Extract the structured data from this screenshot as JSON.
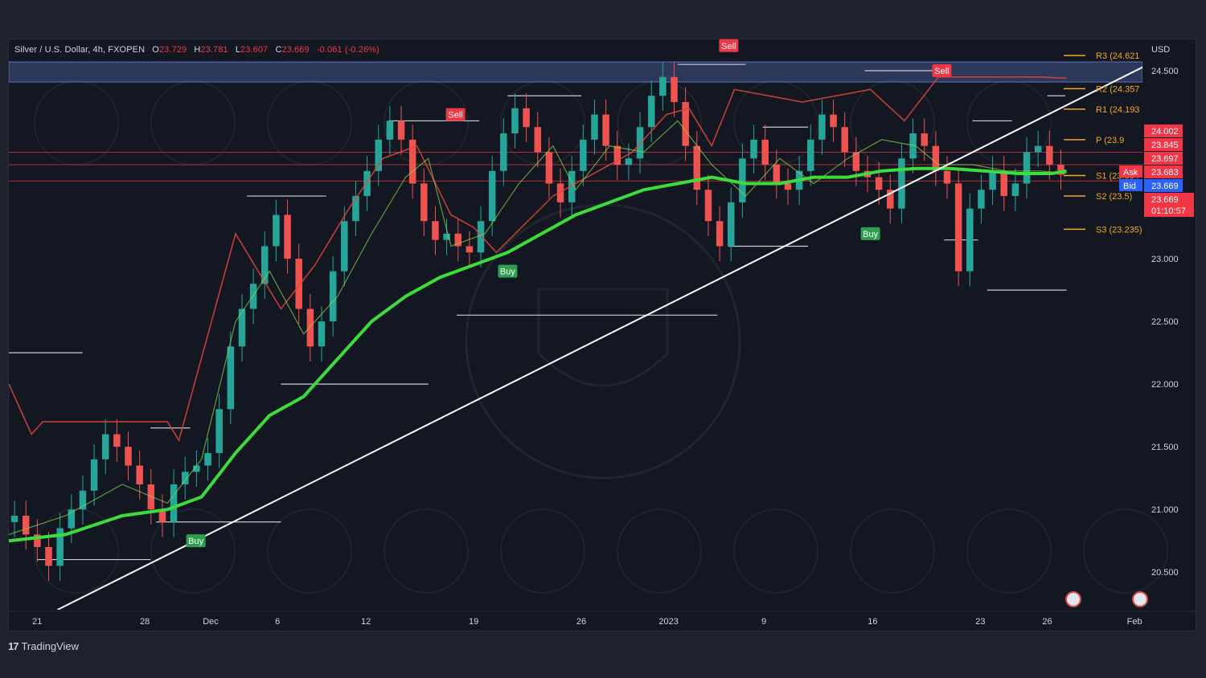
{
  "header": {
    "symbol": "Silver / U.S. Dollar, 4h, FXOPEN",
    "open_label": "O",
    "open": "23.729",
    "high_label": "H",
    "high": "23.781",
    "low_label": "L",
    "low": "23.607",
    "close_label": "C",
    "close": "23.669",
    "change": "-0.061 (-0.26%)"
  },
  "currency": "USD",
  "footer": {
    "logo_glyph": "17",
    "brand": "TradingView"
  },
  "colors": {
    "up": "#26a69a",
    "down": "#ef5350",
    "ema": "#3bdc3b",
    "pivot": "#f5a623",
    "resistance_zone": "#5b73c4"
  },
  "chart_data": {
    "type": "candlestick",
    "timeframe": "4h",
    "y_range": [
      20.2,
      24.75
    ],
    "y_ticks": [
      "20.500",
      "21.000",
      "21.500",
      "22.000",
      "22.500",
      "23.000",
      "23.500",
      "24.000",
      "24.500"
    ],
    "x_range": [
      0,
      100
    ],
    "x_ticks": [
      {
        "label": "21",
        "x": 2.5
      },
      {
        "label": "28",
        "x": 12
      },
      {
        "label": "Dec",
        "x": 17.8
      },
      {
        "label": "6",
        "x": 23.7
      },
      {
        "label": "12",
        "x": 31.5
      },
      {
        "label": "19",
        "x": 41
      },
      {
        "label": "26",
        "x": 50.5
      },
      {
        "label": "2023",
        "x": 58.2
      },
      {
        "label": "9",
        "x": 66.6
      },
      {
        "label": "16",
        "x": 76.2
      },
      {
        "label": "23",
        "x": 85.7
      },
      {
        "label": "26",
        "x": 91.6
      },
      {
        "label": "Feb",
        "x": 99.3
      }
    ],
    "last": {
      "ask": "Ask",
      "bid": "Bid",
      "bid_value": "23.669",
      "price": "23.669",
      "countdown": "01:10:57"
    },
    "price_tags": [
      "24.002",
      "23.845",
      "23.697",
      "23.683"
    ],
    "pivots": [
      {
        "label": "R3 (24.621",
        "value": 24.621
      },
      {
        "label": "R2 (24.357",
        "value": 24.357
      },
      {
        "label": "R1 (24.193",
        "value": 24.193
      },
      {
        "label": "P (23.9",
        "value": 23.95
      },
      {
        "label": "S1 (23.664",
        "value": 23.664
      },
      {
        "label": "S2 (23.5)",
        "value": 23.5
      },
      {
        "label": "S3 (23.235)",
        "value": 23.235
      }
    ],
    "resistance_zone": [
      24.41,
      24.57
    ],
    "signals": [
      {
        "label": "Sell",
        "x": 39.4,
        "y": 24.15
      },
      {
        "label": "Sell",
        "x": 63.5,
        "y": 24.7
      },
      {
        "label": "Sell",
        "x": 82.3,
        "y": 24.5
      },
      {
        "label": "Buy",
        "x": 16.5,
        "y": 20.75
      },
      {
        "label": "Buy",
        "x": 44,
        "y": 22.9
      },
      {
        "label": "Buy",
        "x": 76,
        "y": 23.2
      }
    ],
    "trendline": [
      [
        4.3,
        20.2
      ],
      [
        100.5,
        24.55
      ]
    ],
    "support_levels": [
      {
        "x0": 0,
        "x1": 6.5,
        "y": 22.25
      },
      {
        "x0": 2.5,
        "x1": 12.5,
        "y": 20.6
      },
      {
        "x0": 12.5,
        "x1": 16,
        "y": 21.65
      },
      {
        "x0": 13,
        "x1": 24,
        "y": 20.9
      },
      {
        "x0": 21,
        "x1": 28,
        "y": 23.5
      },
      {
        "x0": 24,
        "x1": 37,
        "y": 22.0
      },
      {
        "x0": 33.5,
        "x1": 41.5,
        "y": 24.1
      },
      {
        "x0": 39.5,
        "x1": 62.5,
        "y": 22.55
      },
      {
        "x0": 44,
        "x1": 50.5,
        "y": 24.3
      },
      {
        "x0": 59,
        "x1": 65,
        "y": 24.55
      },
      {
        "x0": 63.5,
        "x1": 70.5,
        "y": 23.1
      },
      {
        "x0": 66.5,
        "x1": 70.5,
        "y": 24.05
      },
      {
        "x0": 75.5,
        "x1": 82.5,
        "y": 24.5
      },
      {
        "x0": 82.5,
        "x1": 85.5,
        "y": 23.15
      },
      {
        "x0": 85,
        "x1": 88.5,
        "y": 24.1
      },
      {
        "x0": 86.3,
        "x1": 93.3,
        "y": 22.75
      },
      {
        "x0": 91.6,
        "x1": 93.2,
        "y": 24.3
      }
    ],
    "ema_fast": [
      [
        0,
        20.8
      ],
      [
        5,
        20.95
      ],
      [
        10,
        21.2
      ],
      [
        14,
        21.05
      ],
      [
        17,
        21.4
      ],
      [
        20,
        22.5
      ],
      [
        23,
        22.9
      ],
      [
        26,
        22.4
      ],
      [
        29,
        22.7
      ],
      [
        32,
        23.2
      ],
      [
        35,
        23.65
      ],
      [
        37,
        23.8
      ],
      [
        39,
        23.1
      ],
      [
        42,
        23.2
      ],
      [
        45,
        23.6
      ],
      [
        48,
        23.9
      ],
      [
        50,
        23.55
      ],
      [
        53,
        23.9
      ],
      [
        56,
        23.85
      ],
      [
        59,
        24.1
      ],
      [
        62,
        23.75
      ],
      [
        65,
        23.5
      ],
      [
        68,
        23.8
      ],
      [
        71,
        23.6
      ],
      [
        74,
        23.8
      ],
      [
        77,
        23.95
      ],
      [
        80,
        23.9
      ],
      [
        82,
        23.75
      ],
      [
        85,
        23.75
      ],
      [
        88,
        23.7
      ],
      [
        91,
        23.7
      ],
      [
        93.3,
        23.68
      ]
    ],
    "ema_slow": [
      [
        0,
        20.75
      ],
      [
        5,
        20.8
      ],
      [
        10,
        20.95
      ],
      [
        14,
        21.0
      ],
      [
        17,
        21.1
      ],
      [
        20,
        21.45
      ],
      [
        23,
        21.75
      ],
      [
        26,
        21.9
      ],
      [
        29,
        22.2
      ],
      [
        32,
        22.5
      ],
      [
        35,
        22.7
      ],
      [
        38,
        22.85
      ],
      [
        41,
        22.95
      ],
      [
        44,
        23.05
      ],
      [
        47,
        23.2
      ],
      [
        50,
        23.35
      ],
      [
        53,
        23.45
      ],
      [
        56,
        23.55
      ],
      [
        59,
        23.6
      ],
      [
        62,
        23.65
      ],
      [
        65,
        23.6
      ],
      [
        68,
        23.6
      ],
      [
        71,
        23.65
      ],
      [
        74,
        23.65
      ],
      [
        77,
        23.7
      ],
      [
        80,
        23.72
      ],
      [
        83,
        23.72
      ],
      [
        86,
        23.7
      ],
      [
        89,
        23.68
      ],
      [
        92,
        23.68
      ],
      [
        93.3,
        23.7
      ]
    ],
    "trailing_stop": [
      [
        0,
        22.0
      ],
      [
        2,
        21.6
      ],
      [
        3,
        21.7
      ],
      [
        14,
        21.7
      ],
      [
        15,
        21.55
      ],
      [
        20,
        23.2
      ],
      [
        22,
        22.9
      ],
      [
        24,
        22.6
      ],
      [
        27,
        22.95
      ],
      [
        30,
        23.4
      ],
      [
        33,
        23.8
      ],
      [
        36,
        23.9
      ],
      [
        39,
        23.35
      ],
      [
        41,
        23.25
      ],
      [
        43,
        23.05
      ],
      [
        48,
        23.5
      ],
      [
        52,
        23.7
      ],
      [
        55,
        23.85
      ],
      [
        58,
        24.15
      ],
      [
        60,
        24.2
      ],
      [
        62,
        23.9
      ],
      [
        64,
        24.35
      ],
      [
        67,
        24.3
      ],
      [
        70,
        24.25
      ],
      [
        73,
        24.3
      ],
      [
        76,
        24.35
      ],
      [
        79,
        24.1
      ],
      [
        82,
        24.45
      ],
      [
        85,
        24.45
      ],
      [
        88,
        24.45
      ],
      [
        91,
        24.45
      ],
      [
        93.3,
        24.44
      ]
    ],
    "candles_close": [
      20.95,
      20.8,
      20.7,
      20.55,
      20.85,
      21.0,
      21.15,
      21.4,
      21.6,
      21.5,
      21.35,
      21.2,
      21.0,
      20.9,
      21.2,
      21.3,
      21.35,
      21.45,
      21.8,
      22.3,
      22.6,
      22.8,
      23.1,
      23.35,
      23.0,
      22.6,
      22.3,
      22.5,
      22.9,
      23.3,
      23.5,
      23.7,
      23.95,
      24.1,
      23.95,
      23.6,
      23.3,
      23.15,
      23.2,
      23.1,
      23.05,
      23.3,
      23.7,
      24.0,
      24.2,
      24.05,
      23.85,
      23.6,
      23.45,
      23.7,
      23.95,
      24.15,
      23.9,
      23.75,
      23.8,
      24.05,
      24.3,
      24.45,
      24.25,
      23.9,
      23.55,
      23.3,
      23.1,
      23.45,
      23.8,
      23.95,
      23.75,
      23.6,
      23.55,
      23.7,
      23.95,
      24.15,
      24.05,
      23.85,
      23.7,
      23.65,
      23.55,
      23.4,
      23.8,
      24.0,
      23.9,
      23.7,
      23.6,
      22.9,
      23.4,
      23.55,
      23.7,
      23.5,
      23.6,
      23.85,
      23.9,
      23.75,
      23.67
    ]
  }
}
